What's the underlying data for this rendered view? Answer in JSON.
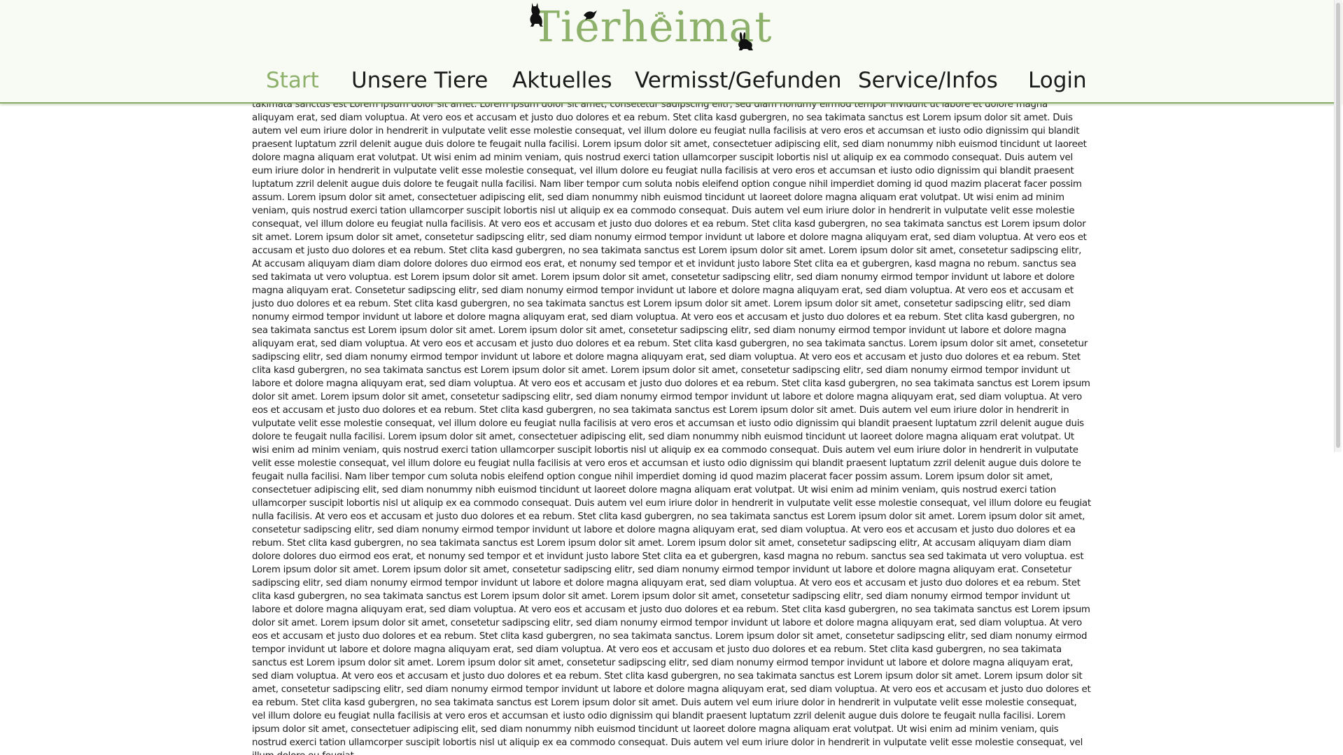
{
  "header": {
    "logo_text": "Tierheimat",
    "logo_icons": [
      "cat-silhouette-icon",
      "bird-silhouette-icon",
      "paw-icon",
      "rabbit-silhouette-icon"
    ],
    "accent_color": "#8db06a"
  },
  "nav": {
    "items": [
      {
        "label": "Start",
        "active": true
      },
      {
        "label": "Unsere Tiere",
        "active": false
      },
      {
        "label": "Aktuelles",
        "active": false
      },
      {
        "label": "Vermisst/Gefunden",
        "active": false
      },
      {
        "label": "Service/Infos",
        "active": false
      },
      {
        "label": "Login",
        "active": false
      }
    ]
  },
  "main": {
    "body_text": "takimata sanctus est Lorem ipsum dolor sit amet. Lorem ipsum dolor sit amet, consetetur sadipscing elitr, sed diam nonumy eirmod tempor invidunt ut labore et dolore magna aliquyam erat, sed diam voluptua. At vero eos et accusam et justo duo dolores et ea rebum. Stet clita kasd gubergren, no sea takimata sanctus est Lorem ipsum dolor sit amet. Duis autem vel eum iriure dolor in hendrerit in vulputate velit esse molestie consequat, vel illum dolore eu feugiat nulla facilisis at vero eros et accumsan et iusto odio dignissim qui blandit praesent luptatum zzril delenit augue duis dolore te feugait nulla facilisi. Lorem ipsum dolor sit amet, consectetuer adipiscing elit, sed diam nonummy nibh euismod tincidunt ut laoreet dolore magna aliquam erat volutpat. Ut wisi enim ad minim veniam, quis nostrud exerci tation ullamcorper suscipit lobortis nisl ut aliquip ex ea commodo consequat. Duis autem vel eum iriure dolor in hendrerit in vulputate velit esse molestie consequat, vel illum dolore eu feugiat nulla facilisis at vero eros et accumsan et iusto odio dignissim qui blandit praesent luptatum zzril delenit augue duis dolore te feugait nulla facilisi. Nam liber tempor cum soluta nobis eleifend option congue nihil imperdiet doming id quod mazim placerat facer possim assum. Lorem ipsum dolor sit amet, consectetuer adipiscing elit, sed diam nonummy nibh euismod tincidunt ut laoreet dolore magna aliquam erat volutpat. Ut wisi enim ad minim veniam, quis nostrud exerci tation ullamcorper suscipit lobortis nisl ut aliquip ex ea commodo consequat. Duis autem vel eum iriure dolor in hendrerit in vulputate velit esse molestie consequat, vel illum dolore eu feugiat nulla facilisis. At vero eos et accusam et justo duo dolores et ea rebum. Stet clita kasd gubergren, no sea takimata sanctus est Lorem ipsum dolor sit amet. Lorem ipsum dolor sit amet, consetetur sadipscing elitr, sed diam nonumy eirmod tempor invidunt ut labore et dolore magna aliquyam erat, sed diam voluptua. At vero eos et accusam et justo duo dolores et ea rebum. Stet clita kasd gubergren, no sea takimata sanctus est Lorem ipsum dolor sit amet. Lorem ipsum dolor sit amet, consetetur sadipscing elitr, At accusam aliquyam diam diam dolore dolores duo eirmod eos erat, et nonumy sed tempor et et invidunt justo labore Stet clita ea et gubergren, kasd magna no rebum. sanctus sea sed takimata ut vero voluptua. est Lorem ipsum dolor sit amet. Lorem ipsum dolor sit amet, consetetur sadipscing elitr, sed diam nonumy eirmod tempor invidunt ut labore et dolore magna aliquyam erat. Consetetur sadipscing elitr, sed diam nonumy eirmod tempor invidunt ut labore et dolore magna aliquyam erat, sed diam voluptua. At vero eos et accusam et justo duo dolores et ea rebum. Stet clita kasd gubergren, no sea takimata sanctus est Lorem ipsum dolor sit amet. Lorem ipsum dolor sit amet, consetetur sadipscing elitr, sed diam nonumy eirmod tempor invidunt ut labore et dolore magna aliquyam erat, sed diam voluptua. At vero eos et accusam et justo duo dolores et ea rebum. Stet clita kasd gubergren, no sea takimata sanctus est Lorem ipsum dolor sit amet. Lorem ipsum dolor sit amet, consetetur sadipscing elitr, sed diam nonumy eirmod tempor invidunt ut labore et dolore magna aliquyam erat, sed diam voluptua. At vero eos et accusam et justo duo dolores et ea rebum. Stet clita kasd gubergren, no sea takimata sanctus. Lorem ipsum dolor sit amet, consetetur sadipscing elitr, sed diam nonumy eirmod tempor invidunt ut labore et dolore magna aliquyam erat, sed diam voluptua. At vero eos et accusam et justo duo dolores et ea rebum. Stet clita kasd gubergren, no sea takimata sanctus est Lorem ipsum dolor sit amet. Lorem ipsum dolor sit amet, consetetur sadipscing elitr, sed diam nonumy eirmod tempor invidunt ut labore et dolore magna aliquyam erat, sed diam voluptua. At vero eos et accusam et justo duo dolores et ea rebum. Stet clita kasd gubergren, no sea takimata sanctus est Lorem ipsum dolor sit amet. Lorem ipsum dolor sit amet, consetetur sadipscing elitr, sed diam nonumy eirmod tempor invidunt ut labore et dolore magna aliquyam erat, sed diam voluptua. At vero eos et accusam et justo duo dolores et ea rebum. Stet clita kasd gubergren, no sea takimata sanctus est Lorem ipsum dolor sit amet. Duis autem vel eum iriure dolor in hendrerit in vulputate velit esse molestie consequat, vel illum dolore eu feugiat nulla facilisis at vero eros et accumsan et iusto odio dignissim qui blandit praesent luptatum zzril delenit augue duis dolore te feugait nulla facilisi. Lorem ipsum dolor sit amet, consectetuer adipiscing elit, sed diam nonummy nibh euismod tincidunt ut laoreet dolore magna aliquam erat volutpat. Ut wisi enim ad minim veniam, quis nostrud exerci tation ullamcorper suscipit lobortis nisl ut aliquip ex ea commodo consequat. Duis autem vel eum iriure dolor in hendrerit in vulputate velit esse molestie consequat, vel illum dolore eu feugiat nulla facilisis at vero eros et accumsan et iusto odio dignissim qui blandit praesent luptatum zzril delenit augue duis dolore te feugait nulla facilisi. Nam liber tempor cum soluta nobis eleifend option congue nihil imperdiet doming id quod mazim placerat facer possim assum. Lorem ipsum dolor sit amet, consectetuer adipiscing elit, sed diam nonummy nibh euismod tincidunt ut laoreet dolore magna aliquam erat volutpat. Ut wisi enim ad minim veniam, quis nostrud exerci tation ullamcorper suscipit lobortis nisl ut aliquip ex ea commodo consequat. Duis autem vel eum iriure dolor in hendrerit in vulputate velit esse molestie consequat, vel illum dolore eu feugiat nulla facilisis. At vero eos et accusam et justo duo dolores et ea rebum. Stet clita kasd gubergren, no sea takimata sanctus est Lorem ipsum dolor sit amet. Lorem ipsum dolor sit amet, consetetur sadipscing elitr, sed diam nonumy eirmod tempor invidunt ut labore et dolore magna aliquyam erat, sed diam voluptua. At vero eos et accusam et justo duo dolores et ea rebum. Stet clita kasd gubergren, no sea takimata sanctus est Lorem ipsum dolor sit amet. Lorem ipsum dolor sit amet, consetetur sadipscing elitr, At accusam aliquyam diam diam dolore dolores duo eirmod eos erat, et nonumy sed tempor et et invidunt justo labore Stet clita ea et gubergren, kasd magna no rebum. sanctus sea sed takimata ut vero voluptua. est Lorem ipsum dolor sit amet. Lorem ipsum dolor sit amet, consetetur sadipscing elitr, sed diam nonumy eirmod tempor invidunt ut labore et dolore magna aliquyam erat. Consetetur sadipscing elitr, sed diam nonumy eirmod tempor invidunt ut labore et dolore magna aliquyam erat, sed diam voluptua. At vero eos et accusam et justo duo dolores et ea rebum. Stet clita kasd gubergren, no sea takimata sanctus est Lorem ipsum dolor sit amet. Lorem ipsum dolor sit amet, consetetur sadipscing elitr, sed diam nonumy eirmod tempor invidunt ut labore et dolore magna aliquyam erat, sed diam voluptua. At vero eos et accusam et justo duo dolores et ea rebum. Stet clita kasd gubergren, no sea takimata sanctus est Lorem ipsum dolor sit amet. Lorem ipsum dolor sit amet, consetetur sadipscing elitr, sed diam nonumy eirmod tempor invidunt ut labore et dolore magna aliquyam erat, sed diam voluptua. At vero eos et accusam et justo duo dolores et ea rebum. Stet clita kasd gubergren, no sea takimata sanctus. Lorem ipsum dolor sit amet, consetetur sadipscing elitr, sed diam nonumy eirmod tempor invidunt ut labore et dolore magna aliquyam erat, sed diam voluptua. At vero eos et accusam et justo duo dolores et ea rebum. Stet clita kasd gubergren, no sea takimata sanctus est Lorem ipsum dolor sit amet. Lorem ipsum dolor sit amet, consetetur sadipscing elitr, sed diam nonumy eirmod tempor invidunt ut labore et dolore magna aliquyam erat, sed diam voluptua. At vero eos et accusam et justo duo dolores et ea rebum. Stet clita kasd gubergren, no sea takimata sanctus est Lorem ipsum dolor sit amet. Lorem ipsum dolor sit amet, consetetur sadipscing elitr, sed diam nonumy eirmod tempor invidunt ut labore et dolore magna aliquyam erat, sed diam voluptua. At vero eos et accusam et justo duo dolores et ea rebum. Stet clita kasd gubergren, no sea takimata sanctus est Lorem ipsum dolor sit amet. Duis autem vel eum iriure dolor in hendrerit in vulputate velit esse molestie consequat, vel illum dolore eu feugiat nulla facilisis at vero eros et accumsan et iusto odio dignissim qui blandit praesent luptatum zzril delenit augue duis dolore te feugait nulla facilisi. Lorem ipsum dolor sit amet, consectetuer adipiscing elit, sed diam nonummy nibh euismod tincidunt ut laoreet dolore magna aliquam erat volutpat. Ut wisi enim ad minim veniam, quis nostrud exerci tation ullamcorper suscipit lobortis nisl ut aliquip ex ea commodo consequat. Duis autem vel eum iriure dolor in hendrerit in vulputate velit esse molestie consequat, vel illum dolore eu feugiat"
  }
}
